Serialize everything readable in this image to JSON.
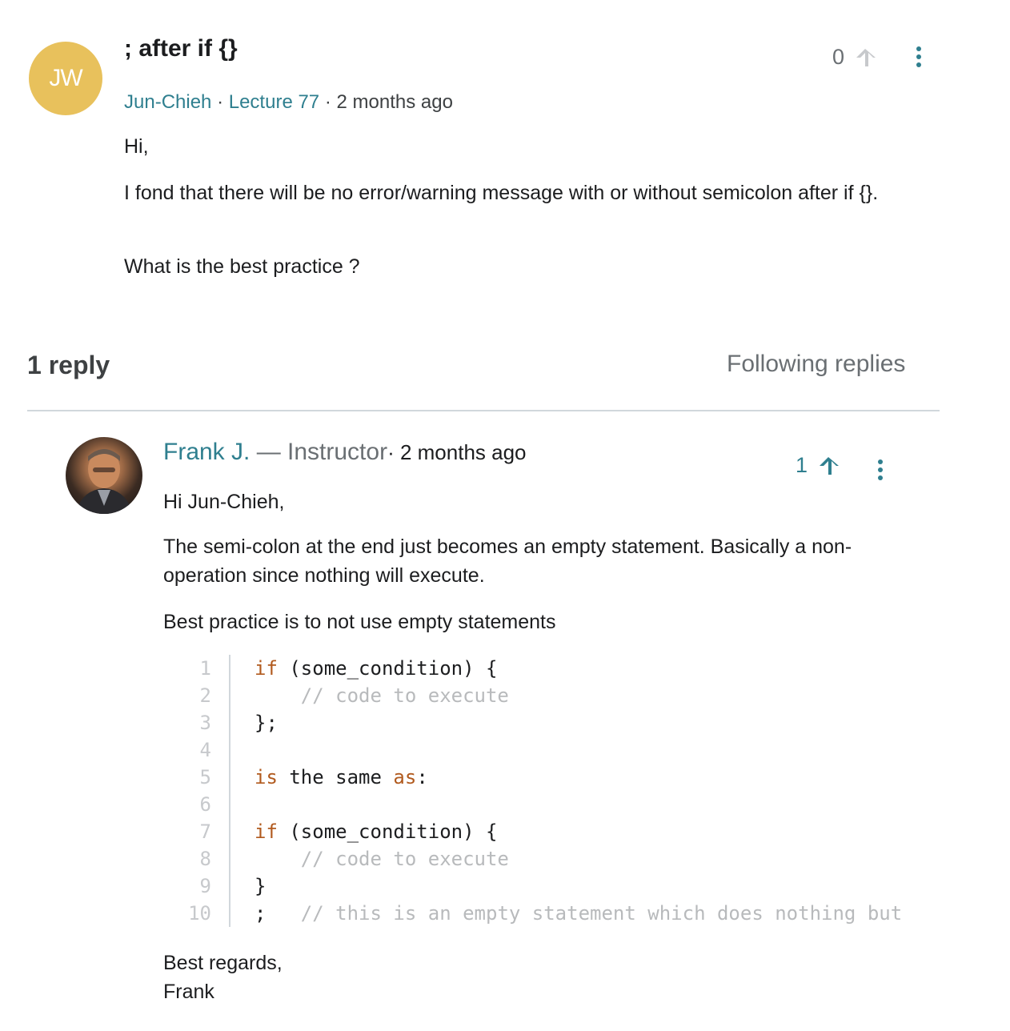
{
  "question": {
    "avatar_initials": "JW",
    "title": "; after if {}",
    "author": "Jun-Chieh",
    "sep1": " · ",
    "lecture": "Lecture 77",
    "time": " · 2 months ago",
    "votes": "0",
    "body": [
      "Hi,",
      "I fond that there will be no error/warning message with or without semicolon after if {}.",
      "What is the best practice ?"
    ]
  },
  "replies": {
    "count_label": "1 reply",
    "following_label": "Following replies"
  },
  "reply": {
    "author": "Frank J.",
    "role": " — Instructor",
    "time": "· 2 months ago",
    "votes": "1",
    "body": [
      "Hi Jun-Chieh,",
      "The semi-colon at the end just becomes an empty statement. Basically a non-operation since nothing will execute.",
      "Best practice is to not use empty statements"
    ],
    "code_lines": [
      {
        "n": "1",
        "parts": [
          {
            "t": "if",
            "c": "kw"
          },
          {
            "t": " (some_condition) {",
            "c": ""
          }
        ]
      },
      {
        "n": "2",
        "parts": [
          {
            "t": "    // code to execute",
            "c": "cm"
          }
        ]
      },
      {
        "n": "3",
        "parts": [
          {
            "t": "};",
            "c": ""
          }
        ]
      },
      {
        "n": "4",
        "parts": [
          {
            "t": "",
            "c": ""
          }
        ]
      },
      {
        "n": "5",
        "parts": [
          {
            "t": "is",
            "c": "kw"
          },
          {
            "t": " the same ",
            "c": ""
          },
          {
            "t": "as",
            "c": "kw"
          },
          {
            "t": ":",
            "c": ""
          }
        ]
      },
      {
        "n": "6",
        "parts": [
          {
            "t": "",
            "c": ""
          }
        ]
      },
      {
        "n": "7",
        "parts": [
          {
            "t": "if",
            "c": "kw"
          },
          {
            "t": " (some_condition) {",
            "c": ""
          }
        ]
      },
      {
        "n": "8",
        "parts": [
          {
            "t": "    // code to execute",
            "c": "cm"
          }
        ]
      },
      {
        "n": "9",
        "parts": [
          {
            "t": "}",
            "c": ""
          }
        ]
      },
      {
        "n": "10",
        "parts": [
          {
            "t": ";",
            "c": ""
          },
          {
            "t": "   // this is an empty statement which does nothing but",
            "c": "cm"
          }
        ]
      }
    ],
    "signoff": [
      "Best regards,",
      "Frank"
    ]
  },
  "colors": {
    "avatar_bg": "#e8c15c",
    "link": "#2f7f8f",
    "upvote_inactive": "#c7c9cc",
    "upvote_active": "#2f7f8f",
    "dots": "#2f7f8f",
    "keyword": "#b15a1e",
    "comment": "#b8babc"
  },
  "icons": {
    "upvote": "arrow-up-icon",
    "more": "more-vertical-icon"
  }
}
